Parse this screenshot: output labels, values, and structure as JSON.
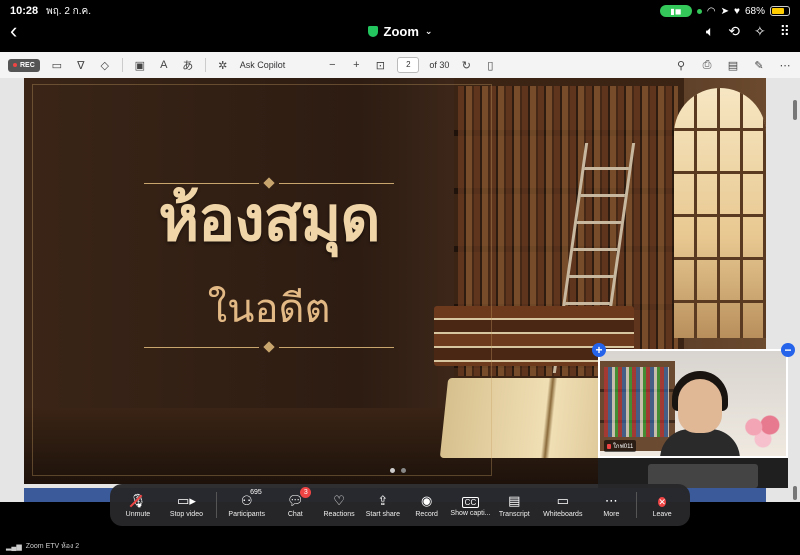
{
  "status_bar": {
    "time": "10:28",
    "date": "พฤ. 2 ก.ค.",
    "battery": "68%"
  },
  "app": {
    "title": "Zoom"
  },
  "pdf_toolbar": {
    "rec_label": "REC",
    "copilot_label": "Ask Copilot",
    "zoom_minus": "−",
    "zoom_plus": "+",
    "page_current": "2",
    "page_total": "of 30"
  },
  "slide": {
    "heading": "ห้องสมุด",
    "subheading": "ในอดีต"
  },
  "video_tile": {
    "name": "ใกฟ011"
  },
  "toolbar": {
    "unmute": "Unmute",
    "stop_video": "Stop video",
    "participants": "Participants",
    "participants_count": "695",
    "chat": "Chat",
    "chat_badge": "3",
    "reactions": "Reactions",
    "start_share": "Start share",
    "record": "Record",
    "show_captions": "Show capti...",
    "transcript": "Transcript",
    "whiteboards": "Whiteboards",
    "more": "More",
    "leave": "Leave"
  },
  "footer": {
    "meeting_name": "Zoom ETV ห้อง 2"
  },
  "colors": {
    "leave": "#ef4444",
    "secure_shield": "#22c55e",
    "tile_controls": "#2563eb"
  }
}
